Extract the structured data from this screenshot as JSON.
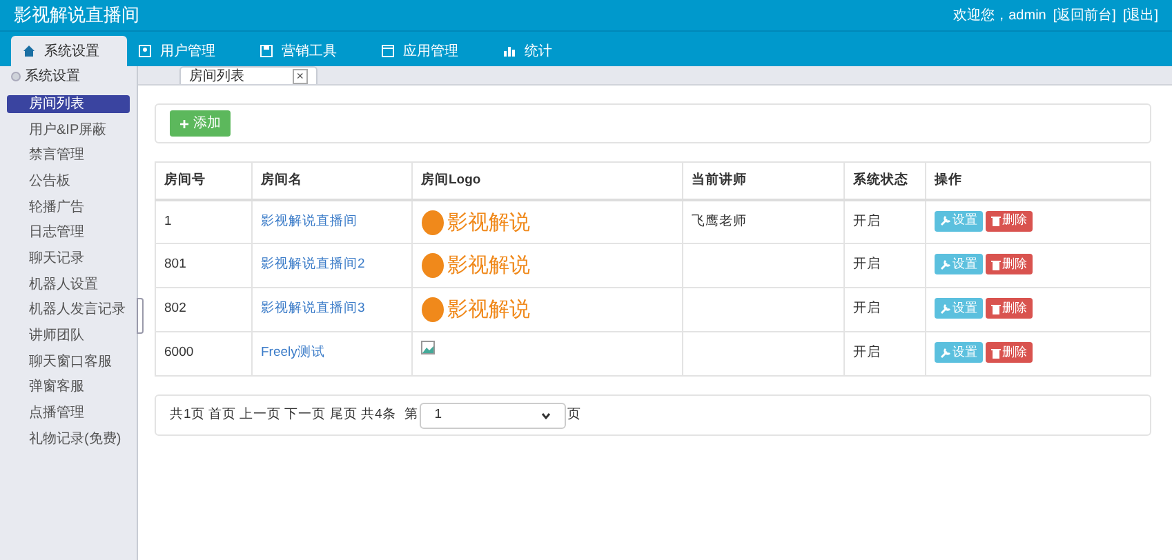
{
  "header": {
    "title": "影视解说直播间",
    "welcome": "欢迎您，admin",
    "links": [
      "[返回前台]",
      "[退出]"
    ]
  },
  "nav": [
    {
      "label": "系统设置",
      "selected": true
    },
    {
      "label": "用户管理",
      "selected": false
    },
    {
      "label": "营销工具",
      "selected": false
    },
    {
      "label": "应用管理",
      "selected": false
    },
    {
      "label": "统计",
      "selected": false
    }
  ],
  "sidebar": {
    "heading": "系统设置",
    "items": [
      {
        "label": "房间列表",
        "selected": true
      },
      {
        "label": "用户&IP屏蔽",
        "selected": false
      },
      {
        "label": "禁言管理",
        "selected": false
      },
      {
        "label": "公告板",
        "selected": false
      },
      {
        "label": "轮播广告",
        "selected": false
      },
      {
        "label": "日志管理",
        "selected": false
      },
      {
        "label": "聊天记录",
        "selected": false
      },
      {
        "label": "机器人设置",
        "selected": false
      },
      {
        "label": "机器人发言记录",
        "selected": false
      },
      {
        "label": "讲师团队",
        "selected": false
      },
      {
        "label": "聊天窗口客服",
        "selected": false
      },
      {
        "label": "弹窗客服",
        "selected": false
      },
      {
        "label": "点播管理",
        "selected": false
      },
      {
        "label": "礼物记录(免费)",
        "selected": false
      }
    ]
  },
  "page_tabs": [
    {
      "label": "房间列表",
      "close": "×"
    }
  ],
  "add_button": {
    "icon": "+",
    "label": "添加"
  },
  "table": {
    "columns": [
      "房间号",
      "房间名",
      "房间Logo",
      "当前讲师",
      "系统状态",
      "操作"
    ],
    "rows": [
      {
        "id": "1",
        "name": "影视解说直播间",
        "logo": {
          "kind": "text",
          "text": "影视解说"
        },
        "teacher": "飞鹰老师",
        "status": "开启",
        "actions": [
          "设置",
          "删除"
        ]
      },
      {
        "id": "801",
        "name": "影视解说直播间2",
        "logo": {
          "kind": "text",
          "text": "影视解说"
        },
        "status": "开启",
        "actions": [
          "设置",
          "删除"
        ]
      },
      {
        "id": "802",
        "name": "影视解说直播间3",
        "logo": {
          "kind": "text",
          "text": "影视解说"
        },
        "status": "开启",
        "actions": [
          "设置",
          "删除"
        ]
      },
      {
        "id": "6000",
        "name": "Freely测试",
        "logo": {
          "kind": "broken"
        },
        "status": "开启",
        "actions": [
          "设置",
          "删除"
        ]
      }
    ]
  },
  "pager": {
    "text": "共1页 首页 上一页 下一页 尾页 共4条",
    "before": "第",
    "page": "1",
    "after": "页"
  }
}
